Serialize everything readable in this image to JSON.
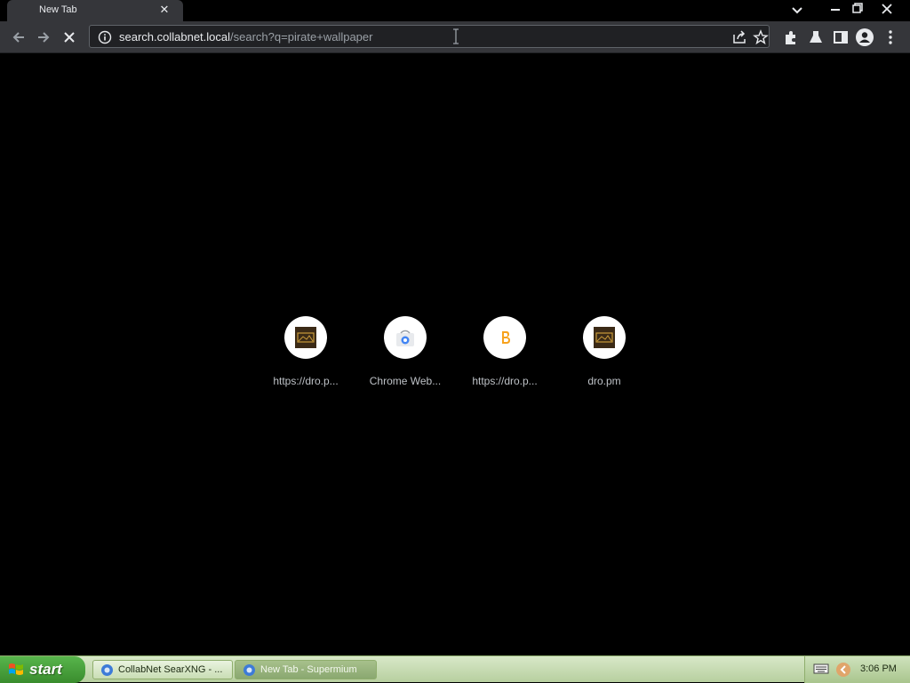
{
  "browser": {
    "tab": {
      "title": "New Tab",
      "close_icon": "close-icon"
    },
    "window_controls": [
      "minimize-icon",
      "restore-icon",
      "close-icon"
    ],
    "address_bar": {
      "host": "search.collabnet.local",
      "path": "/search?q=pirate+wallpaper"
    },
    "toolbar_icons": [
      "back-icon",
      "forward-icon",
      "stop-icon",
      "info-icon",
      "share-icon",
      "star-icon",
      "extensions-icon",
      "labs-icon",
      "side-panel-icon",
      "profile-icon",
      "menu-icon"
    ]
  },
  "shortcuts": [
    {
      "label": "https://dro.p...",
      "icon": "dro-pm-favicon"
    },
    {
      "label": "Chrome Web...",
      "icon": "chrome-web-store-icon"
    },
    {
      "label": "https://dro.p...",
      "icon": "bitcoin-favicon"
    },
    {
      "label": "dro.pm",
      "icon": "dro-pm-favicon"
    }
  ],
  "taskbar": {
    "start_label": "start",
    "tasks": [
      {
        "label": "CollabNet SearXNG - ...",
        "active": false
      },
      {
        "label": "New Tab - Supermium",
        "active": true
      }
    ],
    "clock": "3:06 PM"
  },
  "colors": {
    "tab_bg": "#35363a",
    "toolbar_bg": "#35363a",
    "page_bg": "#000000",
    "taskbar_green": "#3a8c2d"
  }
}
